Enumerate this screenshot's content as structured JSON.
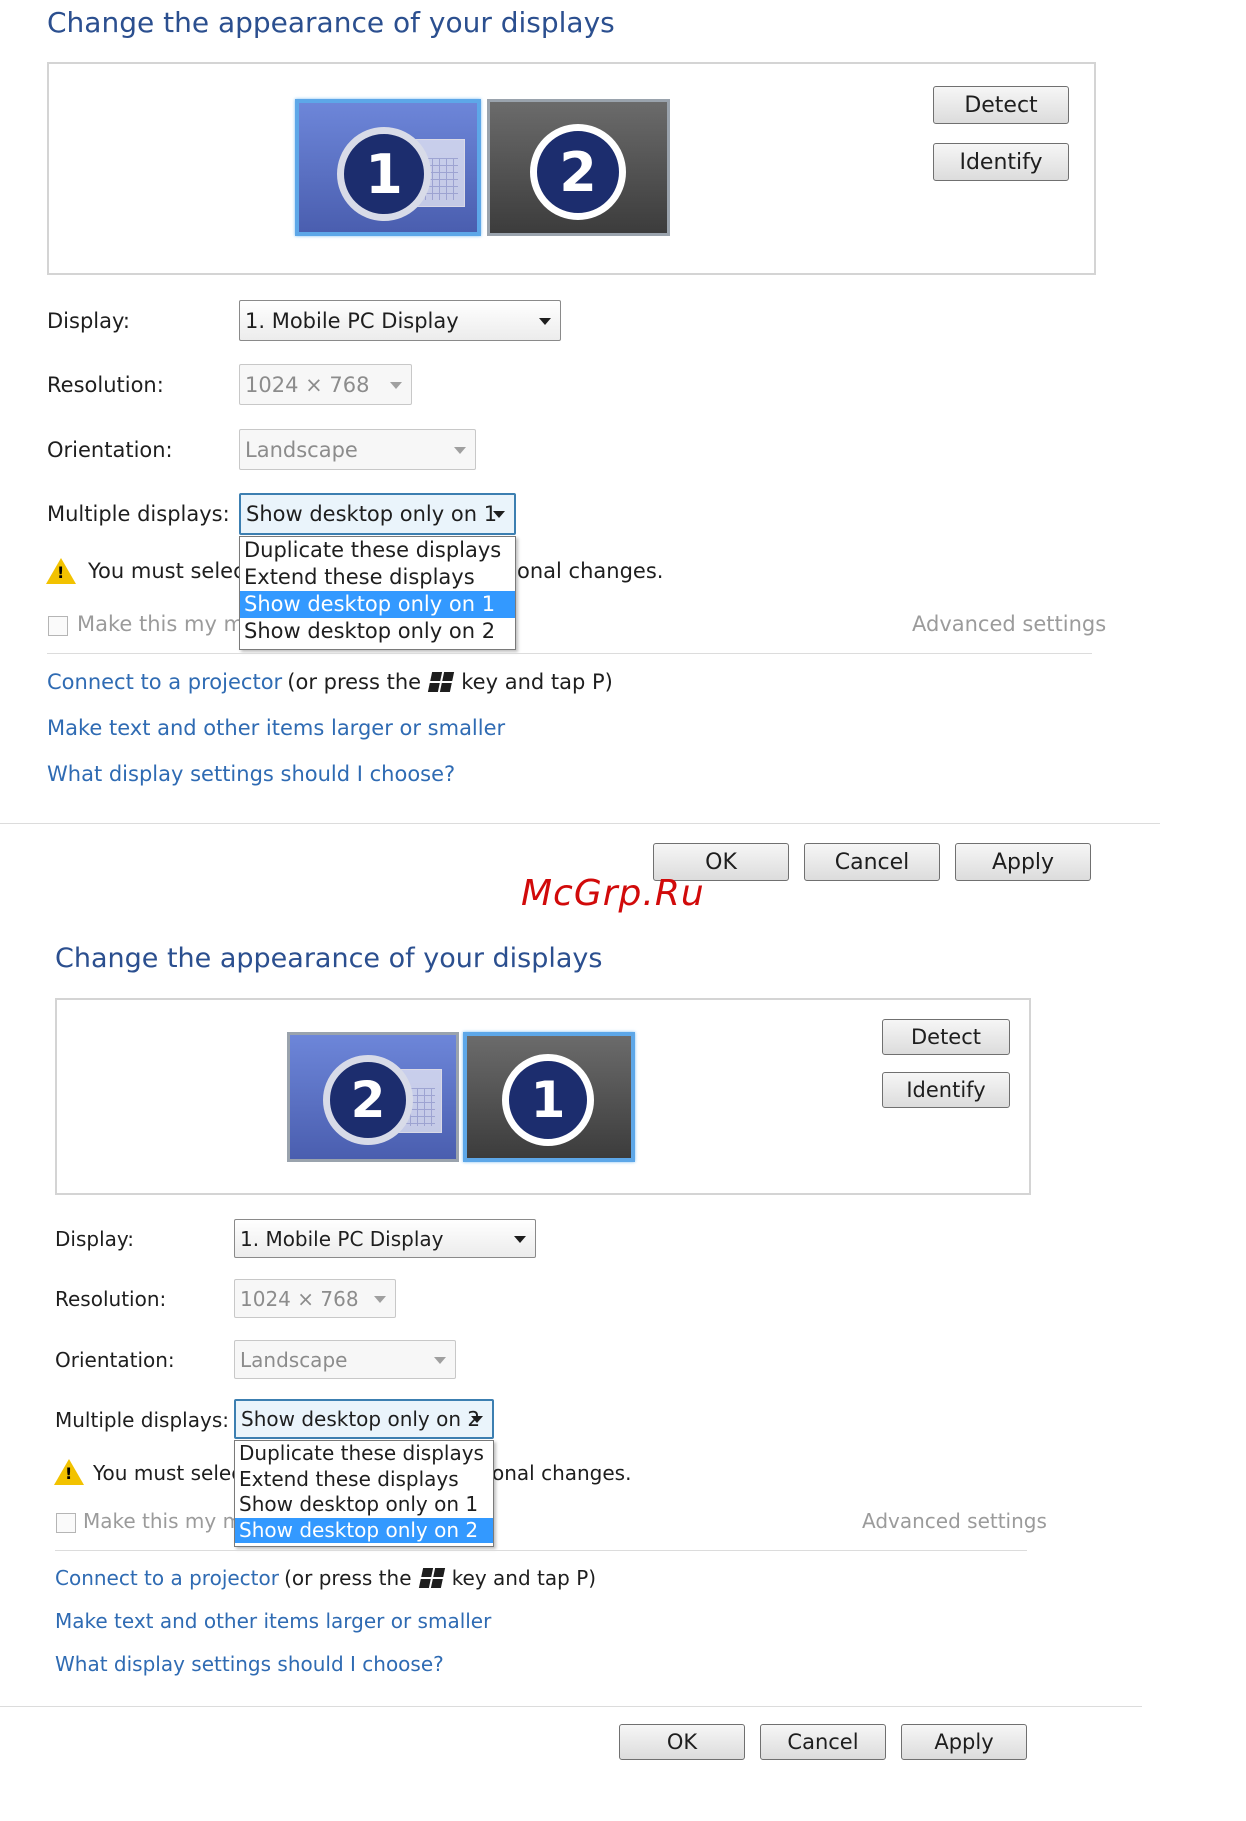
{
  "watermark": "McGrp.Ru",
  "panels": [
    {
      "title": "Change the appearance of your displays",
      "detect_label": "Detect",
      "identify_label": "Identify",
      "monitor_left_number": "1",
      "monitor_right_number": "2",
      "display_label": "Display:",
      "display_value": "1. Mobile PC Display",
      "resolution_label": "Resolution:",
      "resolution_value": "1024 × 768",
      "orientation_label": "Orientation:",
      "orientation_value": "Landscape",
      "multiple_label": "Multiple displays:",
      "multiple_value": "Show desktop only on 1",
      "options": [
        "Duplicate these displays",
        "Extend these displays",
        "Show desktop only on 1",
        "Show desktop only on 2"
      ],
      "selected_option_index": 2,
      "warning_start": "You must select",
      "warning_end": "onal changes.",
      "main_display_partial": "Make this my ma",
      "advanced_settings": "Advanced settings",
      "connect_link": "Connect to a projector",
      "connect_rest_1": "(or press the",
      "connect_rest_2": "key and tap P)",
      "text_size_link": "Make text and other items larger or smaller",
      "help_link": "What display settings should I choose?",
      "ok_label": "OK",
      "cancel_label": "Cancel",
      "apply_label": "Apply"
    },
    {
      "title": "Change the appearance of your displays",
      "detect_label": "Detect",
      "identify_label": "Identify",
      "monitor_left_number": "2",
      "monitor_right_number": "1",
      "display_label": "Display:",
      "display_value": "1. Mobile PC Display",
      "resolution_label": "Resolution:",
      "resolution_value": "1024 × 768",
      "orientation_label": "Orientation:",
      "orientation_value": "Landscape",
      "multiple_label": "Multiple displays:",
      "multiple_value": "Show desktop only on 2",
      "options": [
        "Duplicate these displays",
        "Extend these displays",
        "Show desktop only on 1",
        "Show desktop only on 2"
      ],
      "selected_option_index": 3,
      "warning_start": "You must select",
      "warning_end": "onal changes.",
      "main_display_partial": "Make this my ma",
      "advanced_settings": "Advanced settings",
      "connect_link": "Connect to a projector",
      "connect_rest_1": "(or press the",
      "connect_rest_2": "key and tap P)",
      "text_size_link": "Make text and other items larger or smaller",
      "help_link": "What display settings should I choose?",
      "ok_label": "OK",
      "cancel_label": "Cancel",
      "apply_label": "Apply"
    }
  ]
}
